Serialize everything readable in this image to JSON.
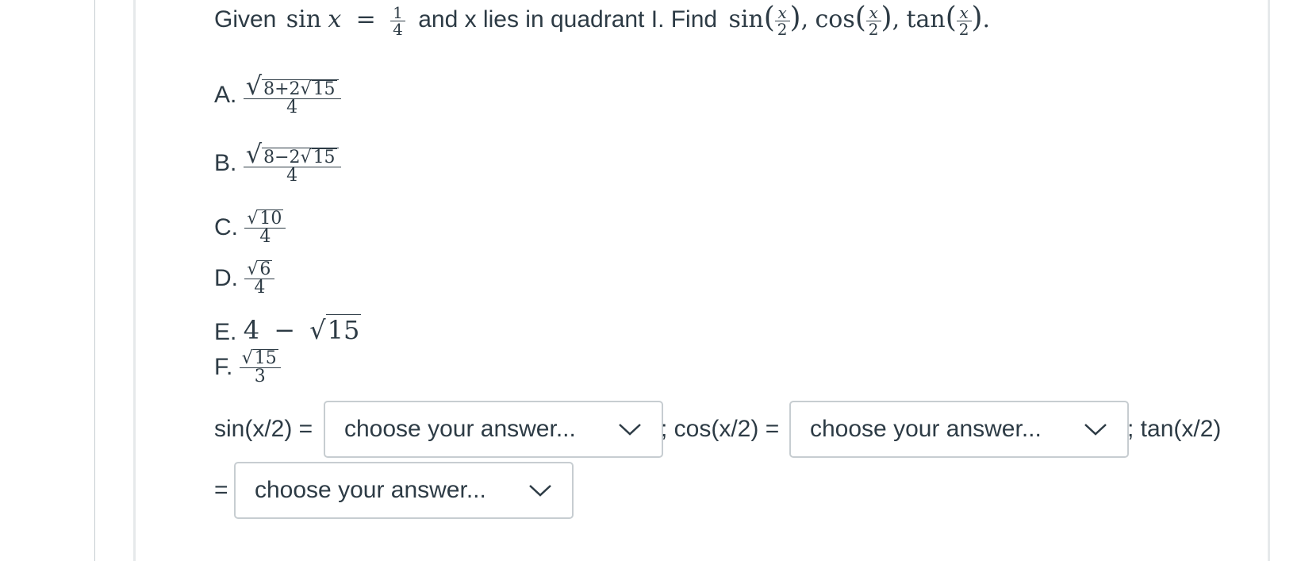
{
  "question": {
    "given_label": "Given",
    "sin_label": "sin",
    "var_x": "x",
    "equals": "=",
    "one": "1",
    "four": "4",
    "middle_text": "and x lies in quadrant I. Find",
    "cos_label": "cos",
    "tan_label": "tan",
    "two": "2",
    "comma": ",",
    "period": "."
  },
  "choices": [
    {
      "letter": "A.",
      "inner_left": "8+2",
      "inner_sqrt": "15",
      "den": "4"
    },
    {
      "letter": "B.",
      "inner_left": "8−2",
      "inner_sqrt": "15",
      "den": "4"
    },
    {
      "letter": "C.",
      "sqrt": "10",
      "den": "4"
    },
    {
      "letter": "D.",
      "sqrt": "6",
      "den": "4"
    },
    {
      "letter": "E.",
      "lead": "4",
      "minus": "−",
      "sqrt": "15"
    },
    {
      "letter": "F.",
      "sqrt": "15",
      "den": "3"
    }
  ],
  "answers": {
    "sin_label": "sin(x/2) =",
    "cos_label": "; cos(x/2) =",
    "tan_label": "; tan(x/2)",
    "equals": "=",
    "placeholder": "choose your answer...",
    "sin_value": "choose your answer...",
    "cos_value": "choose your answer...",
    "tan_value": "choose your answer..."
  },
  "icons": {
    "dropdown": "chevron-down-icon"
  },
  "colors": {
    "text": "#2d3b45",
    "border": "#c7cdd1",
    "background": "#ffffff"
  }
}
